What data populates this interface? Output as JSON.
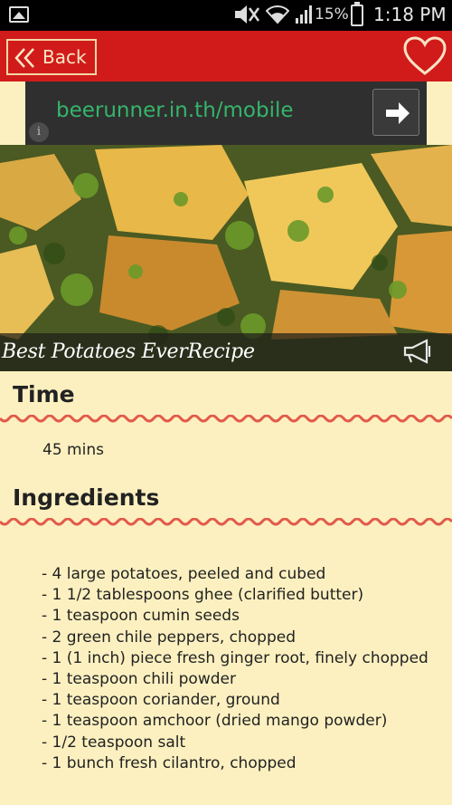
{
  "status_bar": {
    "battery_percent": "15%",
    "time": "1:18 PM"
  },
  "header": {
    "back_label": "Back"
  },
  "ad": {
    "url_text": "beerunner.in.th/mobile",
    "info_glyph": "i"
  },
  "recipe": {
    "title": "Best Potatoes EverRecipe",
    "time_heading": "Time",
    "time_value": "45 mins",
    "ingredients_heading": "Ingredients",
    "ingredients": [
      "-  4 large potatoes, peeled and cubed",
      "-  1 1/2 tablespoons ghee (clarified butter)",
      "-  1 teaspoon cumin seeds",
      "-  2 green chile peppers, chopped",
      "-  1 (1 inch) piece fresh ginger root, finely chopped",
      "-  1 teaspoon chili powder",
      "-  1 teaspoon coriander, ground",
      "-  1 teaspoon amchoor (dried mango powder)",
      "-  1/2 teaspoon salt",
      "-  1 bunch fresh cilantro, chopped"
    ]
  },
  "colors": {
    "header_red": "#d11b1b",
    "page_bg": "#fcf0c0",
    "wave_red": "#e25a4a",
    "ad_text_green": "#35b56a"
  },
  "icons": [
    "image-icon",
    "mute-icon",
    "wifi-icon",
    "signal-icon",
    "battery-icon",
    "chevron-left-double-icon",
    "heart-icon",
    "arrow-right-icon",
    "info-icon",
    "megaphone-icon"
  ]
}
